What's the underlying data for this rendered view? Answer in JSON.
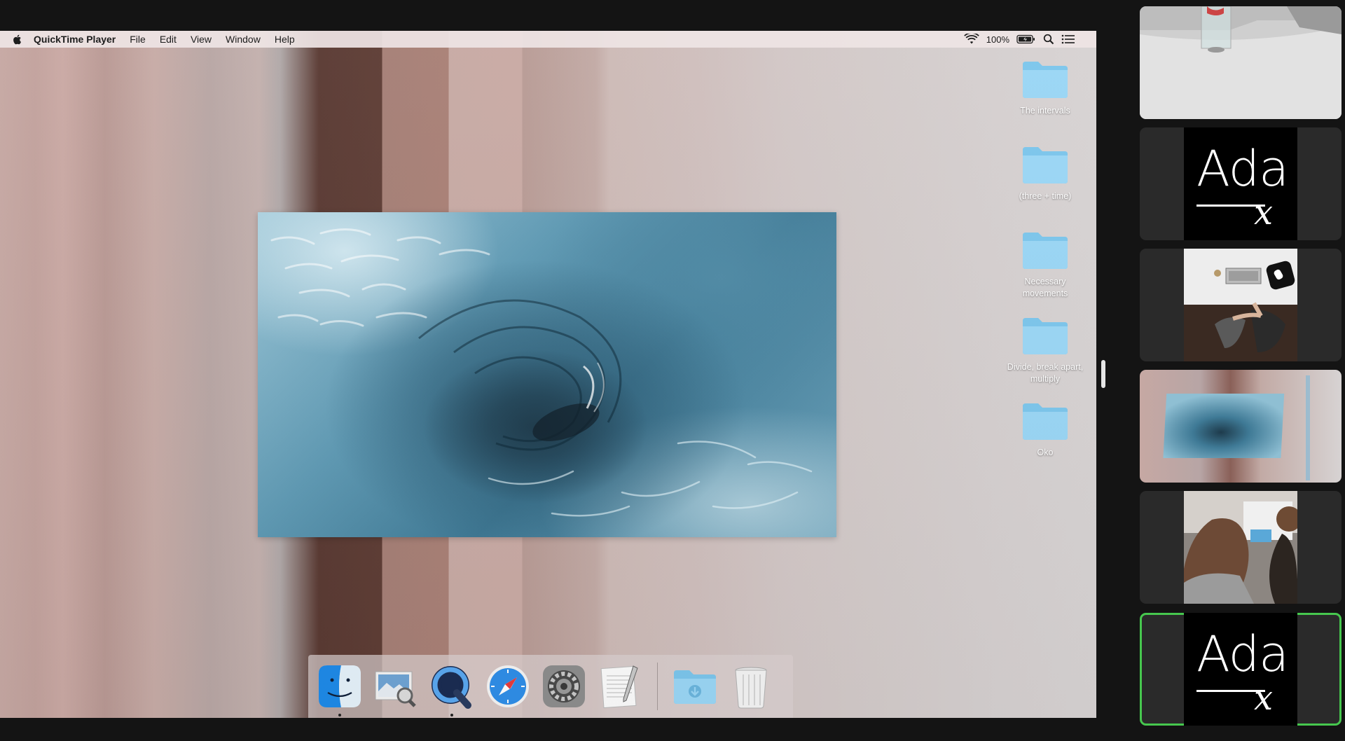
{
  "menubar": {
    "app_name": "QuickTime Player",
    "items": [
      "File",
      "Edit",
      "View",
      "Window",
      "Help"
    ],
    "battery": "100%",
    "icons": [
      "apple-icon",
      "wifi-icon",
      "battery-charging-icon",
      "spotlight-search-icon",
      "notification-center-icon"
    ]
  },
  "desktop": {
    "folders": [
      {
        "label": "The intervals"
      },
      {
        "label": "(three + time)"
      },
      {
        "label": "Necessary movements"
      },
      {
        "label": "Divide, break apart, multiply"
      },
      {
        "label": "Oko"
      }
    ],
    "folder_color": "#8fd3f4"
  },
  "video": {
    "description_icon": "water-whirlpool-video"
  },
  "dock": {
    "apps": [
      {
        "name": "finder-icon",
        "running": true
      },
      {
        "name": "preview-icon",
        "running": false
      },
      {
        "name": "quicktime-icon",
        "running": true
      },
      {
        "name": "safari-icon",
        "running": false
      },
      {
        "name": "system-preferences-icon",
        "running": false
      },
      {
        "name": "textedit-icon",
        "running": false
      }
    ],
    "right_items": [
      "downloads-folder-icon",
      "trash-icon"
    ]
  },
  "participants": [
    {
      "type": "video",
      "name": "participant-desk-glass",
      "active": false
    },
    {
      "type": "logo",
      "logo_text": "Ada",
      "logo_sub": "x",
      "active": false
    },
    {
      "type": "video",
      "name": "participant-overhead-laptop",
      "active": false
    },
    {
      "type": "video",
      "name": "participant-screen-share",
      "active": false
    },
    {
      "type": "video",
      "name": "participant-two-people-monitor",
      "active": false
    },
    {
      "type": "logo",
      "logo_text": "Ada",
      "logo_sub": "x",
      "active": true
    }
  ],
  "colors": {
    "active_speaker": "#46c74e",
    "background": "#141414"
  }
}
